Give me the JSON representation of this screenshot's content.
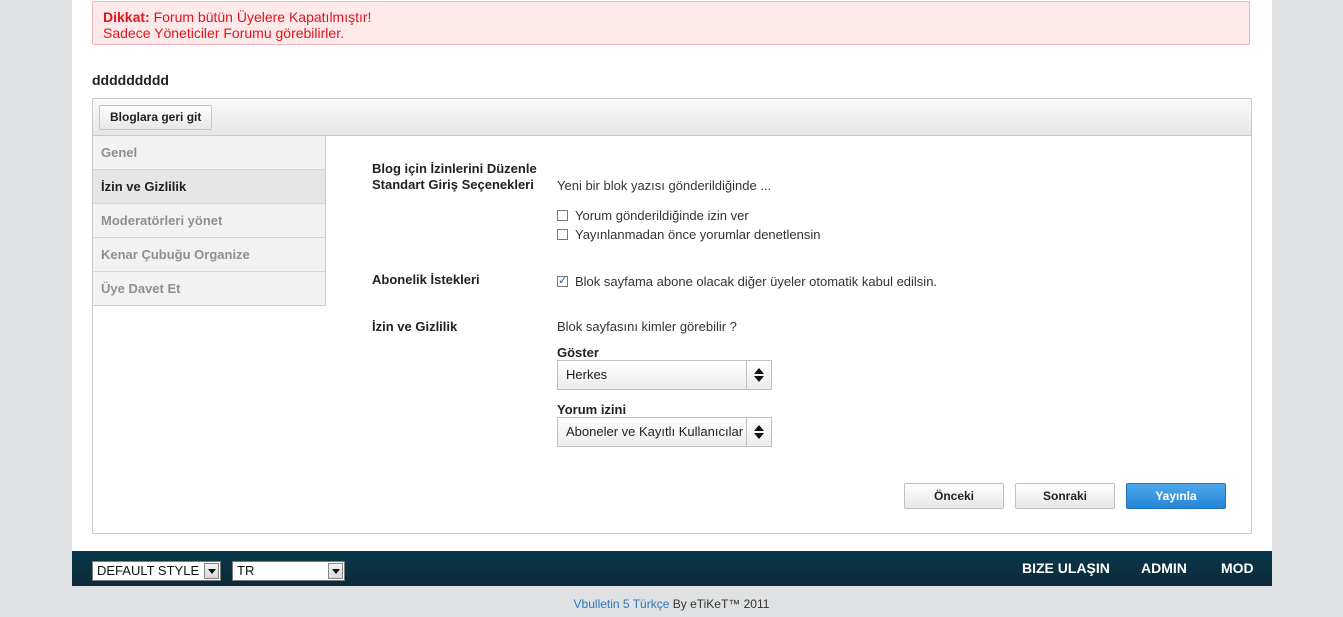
{
  "alert": {
    "prefix": "Dikkat:",
    "line1": "Forum bütün Üyelere Kapatılmıştır!",
    "line2": "Sadece Yöneticiler Forumu görebilirler."
  },
  "blog_title": "ddddddddd",
  "toolbar": {
    "back_label": "Bloglara geri git"
  },
  "sidebar": {
    "items": [
      {
        "label": "Genel"
      },
      {
        "label": "İzin ve Gizlilik"
      },
      {
        "label": "Moderatörleri yönet"
      },
      {
        "label": "Kenar Çubuğu Organize"
      },
      {
        "label": "Üye Davet Et"
      }
    ],
    "active_index": 1
  },
  "form": {
    "heading": "Blog için İzinlerini Düzenle",
    "entry_options_label": "Standart Giriş Seçenekleri",
    "entry_options_desc": "Yeni bir blok yazısı gönderildiğinde ...",
    "checkbox_allow_comments": {
      "label": "Yorum gönderildiğinde izin ver",
      "checked": false
    },
    "checkbox_moderate_comments": {
      "label": "Yayınlanmadan önce yorumlar denetlensin",
      "checked": false
    },
    "subscription_label": "Abonelik İstekleri",
    "checkbox_auto_accept": {
      "label": "Blok sayfama abone olacak diğer üyeler otomatik kabul edilsin.",
      "checked": true
    },
    "privacy_label": "İzin ve Gizlilik",
    "privacy_desc": "Blok sayfasını kimler görebilir ?",
    "show_label": "Göster",
    "show_value": "Herkes",
    "comment_perm_label": "Yorum izini",
    "comment_perm_value": "Aboneler ve Kayıtlı Kullanıcılar"
  },
  "actions": {
    "prev": "Önceki",
    "next": "Sonraki",
    "publish": "Yayınla"
  },
  "footer": {
    "style_select": "DEFAULT STYLE",
    "lang_select": "TR",
    "links": [
      "BIZE ULAŞIN",
      "ADMIN",
      "MOD"
    ],
    "credit_link": "Vbulletin 5 Türkçe",
    "credit_text": " By eTiKeT™ 2011"
  },
  "colors": {
    "alert_text": "#e0161b",
    "alert_bg": "#fde8ea",
    "primary_button": "#2585d6",
    "footer_bar": "#0c2a3a",
    "link": "#2a78c2"
  }
}
